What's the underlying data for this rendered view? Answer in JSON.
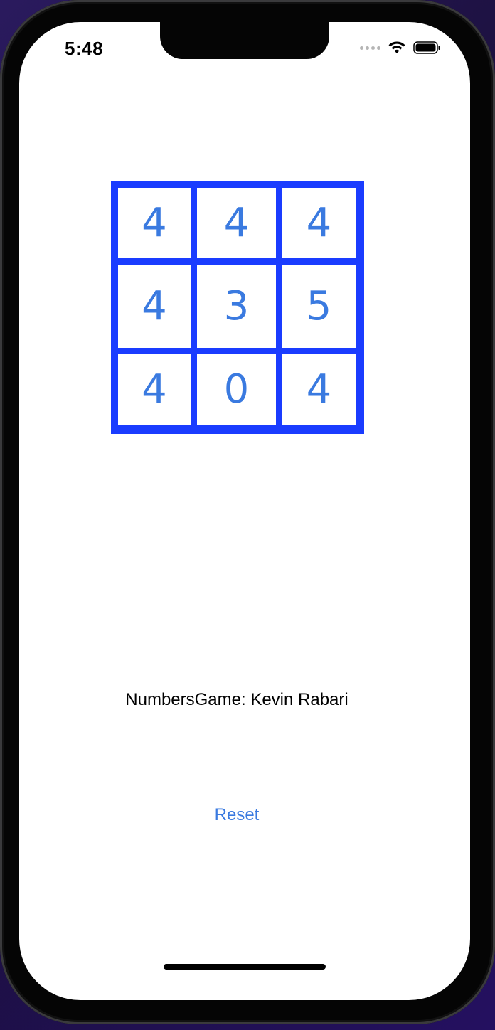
{
  "status_bar": {
    "time": "5:48"
  },
  "grid": {
    "cells": [
      [
        "4",
        "4",
        "4"
      ],
      [
        "4",
        "3",
        "5"
      ],
      [
        "4",
        "0",
        "4"
      ]
    ]
  },
  "title": "NumbersGame: Kevin Rabari",
  "reset_label": "Reset",
  "colors": {
    "grid_border": "#1a3cff",
    "cell_text": "#3a7ae0",
    "button_text": "#3a7ae0"
  }
}
